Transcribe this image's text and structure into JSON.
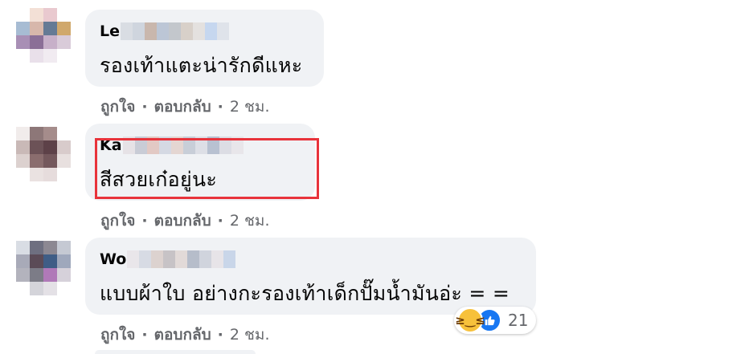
{
  "comments": [
    {
      "author_visible": "Le",
      "text": "รองเท้าแตะน่ารักดีแหะ",
      "actions": {
        "like": "ถูกใจ",
        "reply": "ตอบกลับ",
        "sep": "·",
        "time": "2 ชม."
      }
    },
    {
      "author_visible": "Ka",
      "text": "สีสวยเก๋อยู่นะ",
      "actions": {
        "like": "ถูกใจ",
        "reply": "ตอบกลับ",
        "sep": "·",
        "time": "2 ชม."
      }
    },
    {
      "author_visible": "Wo",
      "text": "แบบผ้าใบ อย่างกะรองเท้าเด็กปั๊มน้ำมันอ่ะ = =",
      "actions": {
        "like": "ถูกใจ",
        "reply": "ตอบกลับ",
        "sep": "·",
        "time": "2 ชม."
      },
      "reactions": {
        "icons": [
          "haha-emoji-icon",
          "like-thumb-icon"
        ],
        "count": "21"
      }
    }
  ],
  "colors": {
    "bubble_bg": "#f0f2f5",
    "meta_text": "#65676b",
    "highlight_border": "#e8333b",
    "like_blue": "#1877f2",
    "haha_yellow": "#f7c13b"
  }
}
